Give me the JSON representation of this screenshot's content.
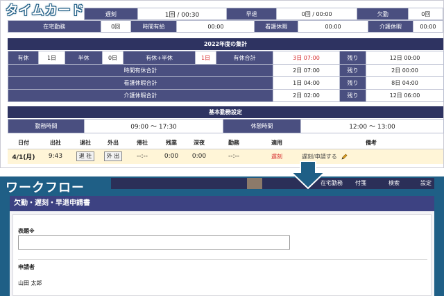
{
  "top_badge": "タイムカード",
  "bottom_badge": "ワークフロー",
  "summary_row1": {
    "cells": [
      {
        "label": "遅刻",
        "value": "1回 / 00:30"
      },
      {
        "label": "早退",
        "value": "0回 / 00:00"
      },
      {
        "label": "欠勤",
        "value": "0回"
      }
    ]
  },
  "summary_row2": {
    "cells": [
      {
        "label": "在宅勤務",
        "value": "0回"
      },
      {
        "label": "時間有給",
        "value": "00:00"
      },
      {
        "label": "看護休暇",
        "value": "00:00"
      },
      {
        "label": "介護休暇",
        "value": "00:00"
      }
    ]
  },
  "annual": {
    "title": "2022年度の集計",
    "row1": [
      {
        "label": "有休",
        "value": "1日"
      },
      {
        "label": "半休",
        "value": "0日"
      },
      {
        "label": "有休+半休",
        "value": "1日"
      },
      {
        "label": "有休合計",
        "value": "3日 07:00"
      },
      {
        "label": "残り",
        "value": "12日 00:00"
      }
    ],
    "rows": [
      {
        "label": "時間有休合計",
        "value": "2日 07:00",
        "rem_label": "残り",
        "rem_value": "2日 00:00"
      },
      {
        "label": "看護休暇合計",
        "value": "1日 04:00",
        "rem_label": "残り",
        "rem_value": "8日 04:00"
      },
      {
        "label": "介護休暇合計",
        "value": "2日 02:00",
        "rem_label": "残り",
        "rem_value": "12日 06:00"
      }
    ]
  },
  "basic": {
    "title": "基本勤務設定",
    "work_label": "勤務時間",
    "work_value": "09:00 〜 17:30",
    "break_label": "休憩時間",
    "break_value": "12:00 〜 13:00"
  },
  "daily": {
    "headers": [
      "日付",
      "出社",
      "退社",
      "外出",
      "帰社",
      "残業",
      "深夜",
      "勤務",
      "適用",
      "備考"
    ],
    "row": {
      "date": "4/1(月)",
      "in": "9:43",
      "out_button": "退 社",
      "goout_button": "外 出",
      "return": "--:--",
      "overtime": "0:00",
      "late_night": "0:00",
      "work": "--:--",
      "applied": "遅刻",
      "note_link": "遅刻/申請する"
    }
  },
  "workflow": {
    "nav": [
      "在宅勤務",
      "付箋",
      "検索",
      "設定"
    ],
    "form_title": "欠勤・遅刻・早退申請書",
    "subject_label": "表題",
    "required_mark": "※",
    "subject_value": "",
    "applicant_label": "申請者",
    "applicant_value": "山田 太郎"
  },
  "colors": {
    "header_purple": "#4a4f80",
    "dark_navy": "#2e3361",
    "badge_blue": "#1f5f86",
    "late_red": "#d6292b",
    "daily_row_bg": "#fff5d7"
  }
}
